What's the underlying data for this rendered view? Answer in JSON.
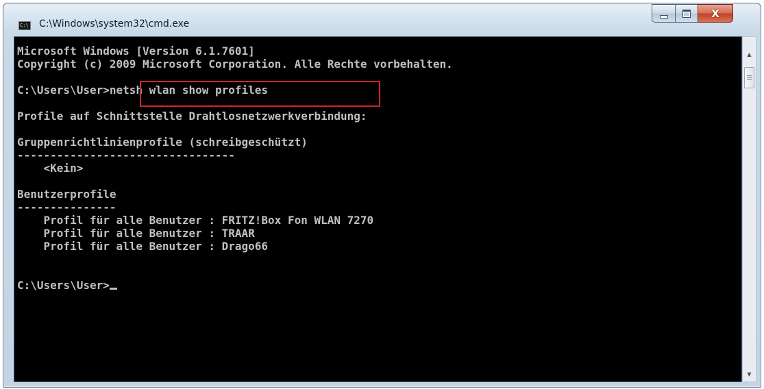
{
  "window": {
    "title": "C:\\Windows\\system32\\cmd.exe",
    "icon": "cmd-icon",
    "icon_text": "C:\\",
    "controls": {
      "minimize": "minimize-icon",
      "maximize": "maximize-icon",
      "close": "close-icon",
      "close_glyph": "X"
    }
  },
  "console": {
    "lines": [
      "Microsoft Windows [Version 6.1.7601]",
      "Copyright (c) 2009 Microsoft Corporation. Alle Rechte vorbehalten.",
      "",
      "C:\\Users\\User>netsh wlan show profiles",
      "",
      "Profile auf Schnittstelle Drahtlosnetzwerkverbindung:",
      "",
      "Gruppenrichtlinienprofile (schreibgeschützt)",
      "---------------------------------",
      "    <Kein>",
      "",
      "Benutzerprofile",
      "---------------",
      "    Profil für alle Benutzer : FRITZ!Box Fon WLAN 7270",
      "    Profil für alle Benutzer : TRAAR",
      "    Profil für alle Benutzer : Drago66",
      "",
      "",
      "C:\\Users\\User>"
    ],
    "text_color": "#c0c0c0",
    "background": "#000000",
    "highlight_color": "#d0262b"
  }
}
